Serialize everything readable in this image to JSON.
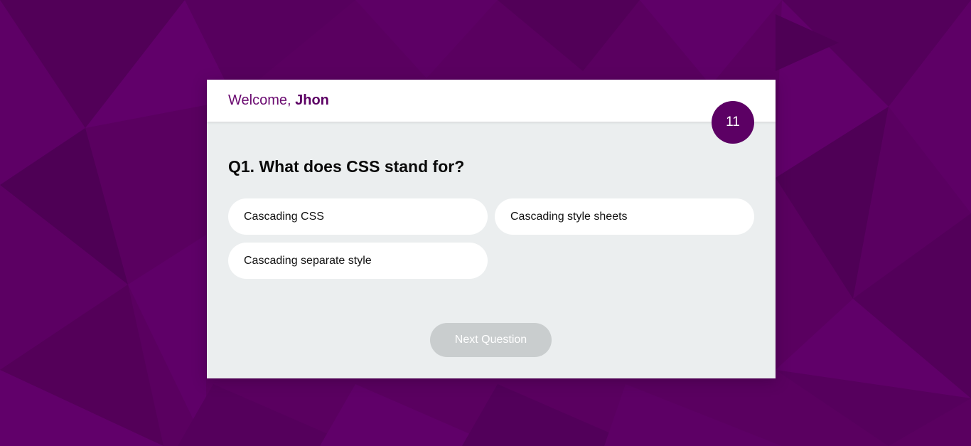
{
  "header": {
    "welcome_prefix": "Welcome, ",
    "user_name": "Jhon"
  },
  "timer": {
    "value": "11"
  },
  "question": {
    "text": "Q1. What does CSS stand for?"
  },
  "options": [
    {
      "label": "Cascading CSS"
    },
    {
      "label": "Cascading style sheets"
    },
    {
      "label": "Cascading separate style"
    }
  ],
  "next_button": {
    "label": "Next Question",
    "state": "disabled"
  },
  "colors": {
    "background": "#5a0060",
    "accent": "#5c0064",
    "card": "#ebeeef",
    "option": "#ffffff",
    "button_disabled": "#c9cdce"
  }
}
